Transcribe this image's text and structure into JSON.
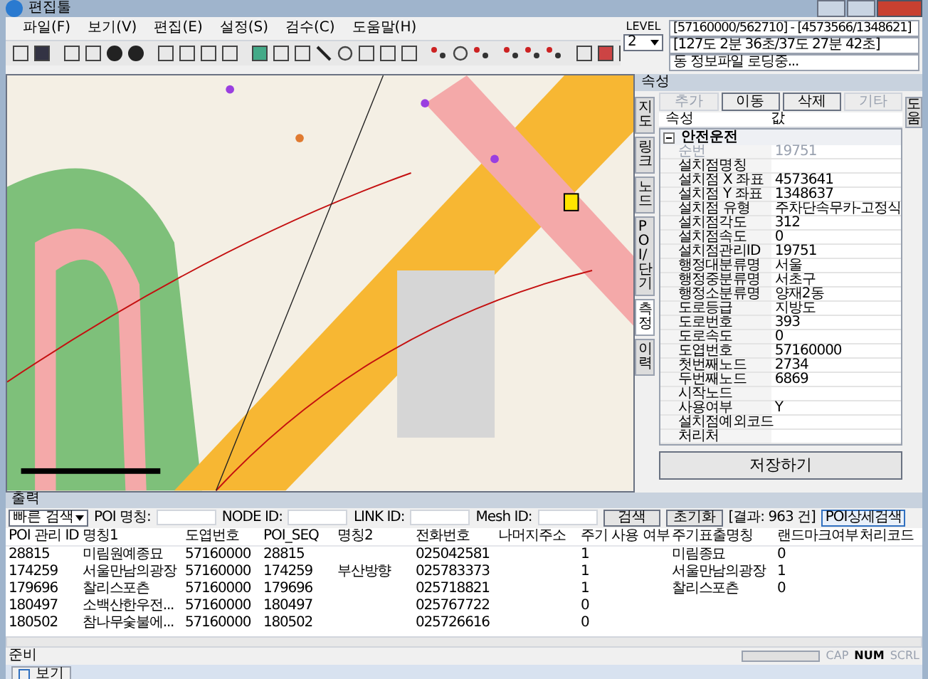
{
  "window": {
    "title": "편집툴"
  },
  "menu": [
    "파일(F)",
    "보기(V)",
    "편집(E)",
    "설정(S)",
    "검수(C)",
    "도움말(H)"
  ],
  "info": {
    "level_label": "LEVEL",
    "level_value": "2",
    "lines": [
      "[57160000/562710] - [4573566/1348621]",
      "[127도 2분 36초/37도 27분 42초]",
      "동 정보파일 로딩중..."
    ]
  },
  "side_tabs": [
    {
      "label": "지도",
      "selected": false
    },
    {
      "label": "링크",
      "selected": false
    },
    {
      "label": "노드",
      "selected": false
    },
    {
      "label": "POI/단기",
      "selected": false
    },
    {
      "label": "측정",
      "selected": true
    },
    {
      "label": "이력",
      "selected": false
    }
  ],
  "right_tab": "도움",
  "properties": {
    "title": "속성",
    "buttons": [
      {
        "label": "추가",
        "disabled": true
      },
      {
        "label": "이동",
        "disabled": false
      },
      {
        "label": "삭제",
        "disabled": false
      },
      {
        "label": "기타",
        "disabled": true
      }
    ],
    "columns": [
      "속성",
      "값"
    ],
    "category": {
      "label": "안전운전",
      "expanded": true
    },
    "rows": [
      {
        "name": "순번",
        "value": "19751",
        "disabled": true
      },
      {
        "name": "설치점명칭",
        "value": "",
        "disabled": false
      },
      {
        "name": "설치점 X 좌표",
        "value": "4573641",
        "disabled": false
      },
      {
        "name": "설치점 Y 좌표",
        "value": "1348637",
        "disabled": false
      },
      {
        "name": "설치점 유형",
        "value": "주차단속무카-고정식",
        "disabled": false
      },
      {
        "name": "설치점각도",
        "value": "312",
        "disabled": false
      },
      {
        "name": "설치점속도",
        "value": "0",
        "disabled": false
      },
      {
        "name": "설치점관리ID",
        "value": "19751",
        "disabled": false
      },
      {
        "name": "행정대분류명",
        "value": "서울",
        "disabled": false
      },
      {
        "name": "행정중분류명",
        "value": "서초구",
        "disabled": false
      },
      {
        "name": "행정소분류명",
        "value": "양재2동",
        "disabled": false
      },
      {
        "name": "도로등급",
        "value": "지방도",
        "disabled": false
      },
      {
        "name": "도로번호",
        "value": "393",
        "disabled": false
      },
      {
        "name": "도로속도",
        "value": "0",
        "disabled": false
      },
      {
        "name": "도엽번호",
        "value": "57160000",
        "disabled": false
      },
      {
        "name": "첫번째노드",
        "value": "2734",
        "disabled": false
      },
      {
        "name": "두번째노드",
        "value": "6869",
        "disabled": false
      },
      {
        "name": "시작노드",
        "value": "",
        "disabled": false
      },
      {
        "name": "사용여부",
        "value": "Y",
        "disabled": false
      },
      {
        "name": "설치점예외코드",
        "value": "",
        "disabled": false
      },
      {
        "name": "처리처",
        "value": "",
        "disabled": false
      }
    ],
    "save_button": "저장하기"
  },
  "output": {
    "title": "출력",
    "search_mode": "빠른 검색",
    "fields": [
      "POI 명칭:",
      "NODE ID:",
      "LINK ID:",
      "Mesh ID:"
    ],
    "buttons": [
      "검색",
      "초기화"
    ],
    "result": "[결과: 963 건]",
    "detail_button": "POI상세검색",
    "columns": [
      "POI 관리 ID",
      "명칭1",
      "도엽번호",
      "POI_SEQ",
      "명칭2",
      "전화번호",
      "나머지주소",
      "주기 사용 여부",
      "주기표출명칭",
      "랜드마크여부",
      "처리코드"
    ],
    "rows": [
      [
        "28815",
        "미림원예종묘",
        "57160000",
        "28815",
        "",
        "025042581",
        "",
        "1",
        "미림종묘",
        "0",
        ""
      ],
      [
        "174259",
        "서울만남의광장",
        "57160000",
        "174259",
        "부산방향",
        "025783373",
        "",
        "1",
        "서울만남의광장",
        "1",
        ""
      ],
      [
        "179696",
        "찰리스포츤",
        "57160000",
        "179696",
        "",
        "025718821",
        "",
        "1",
        "찰리스포츤",
        "0",
        ""
      ],
      [
        "180497",
        "소백산한우전...",
        "57160000",
        "180497",
        "",
        "025767722",
        "",
        "0",
        "",
        "",
        ""
      ],
      [
        "180502",
        "참나무숯불에...",
        "57160000",
        "180502",
        "",
        "025726616",
        "",
        "0",
        "",
        "",
        ""
      ]
    ]
  },
  "status": {
    "text": "준비",
    "progress": {
      "level": 0
    },
    "indicators": [
      {
        "label": "CAP",
        "on": false
      },
      {
        "label": "NUM",
        "on": true
      },
      {
        "label": "SCRL",
        "on": false
      }
    ]
  },
  "bottom_tab": "보기"
}
